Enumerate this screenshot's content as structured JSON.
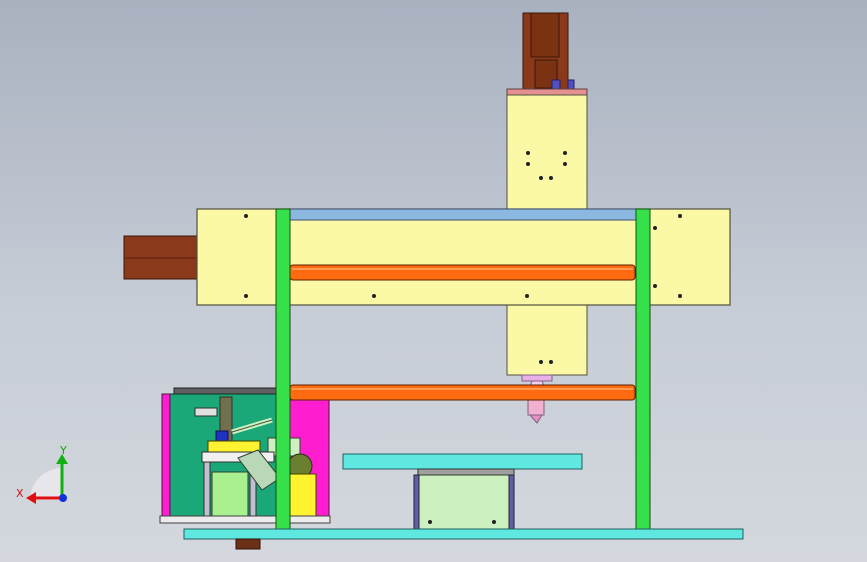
{
  "triad": {
    "x_label": "X",
    "y_label": "Y",
    "x_color": "#e01010",
    "y_color": "#10b010",
    "z_color": "#1030e0"
  },
  "colors": {
    "background_top": "#a9b1c0",
    "plate_yellow": "#fbf8a6",
    "frame_green": "#35e04a",
    "rod_orange": "#ff6a10",
    "motor_brown": "#8a3a1a",
    "base_cyan": "#5ee8e0",
    "box_green": "#1aa878",
    "panel_magenta": "#ff1ecf",
    "table_light_green": "#cdf0c0"
  }
}
